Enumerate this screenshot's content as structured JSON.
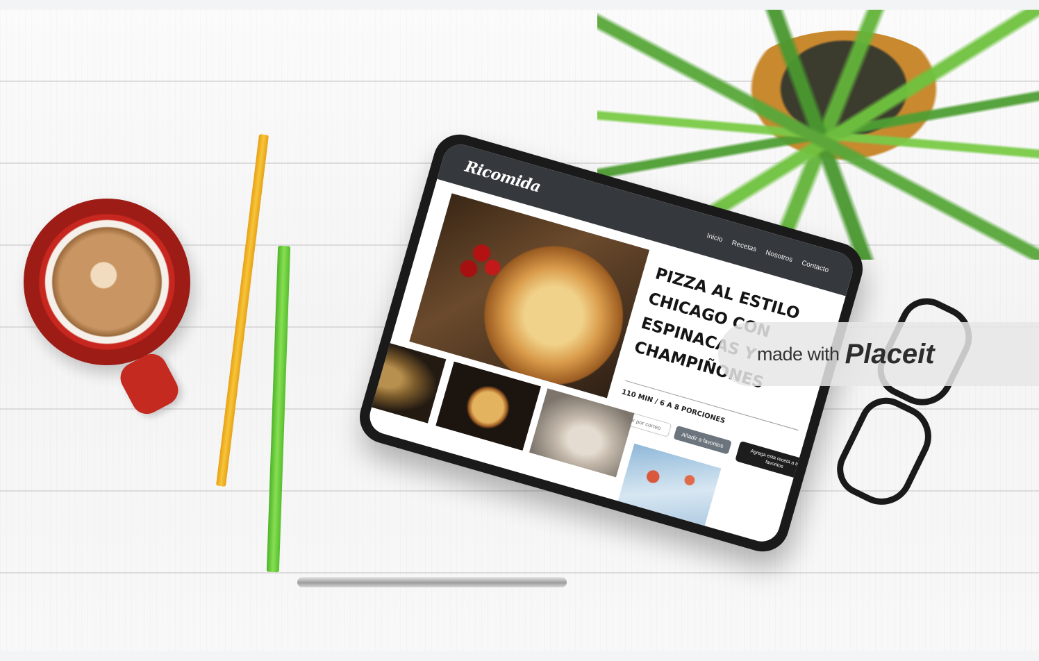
{
  "tablet_site": {
    "brand": "Ricomida",
    "nav": [
      "Inicio",
      "Recetas",
      "Nosotros",
      "Contacto"
    ],
    "recipe": {
      "title": "PIZZA AL ESTILO CHICAGO CON ESPINACAS Y CHAMPIÑONES",
      "meta": "110 MIN / 6 A 8 PORCIONES"
    },
    "email_placeholder": "Enviar por correo",
    "favorite_button": "Añadir a favoritos",
    "tooltip": "Agrega esta receta a tus favoritos"
  },
  "watermark": {
    "text": "made with",
    "logo": "Placeit"
  },
  "colors": {
    "navbar": "#35393d",
    "button": "#6c757d",
    "tooltip": "#1d1d1d"
  }
}
